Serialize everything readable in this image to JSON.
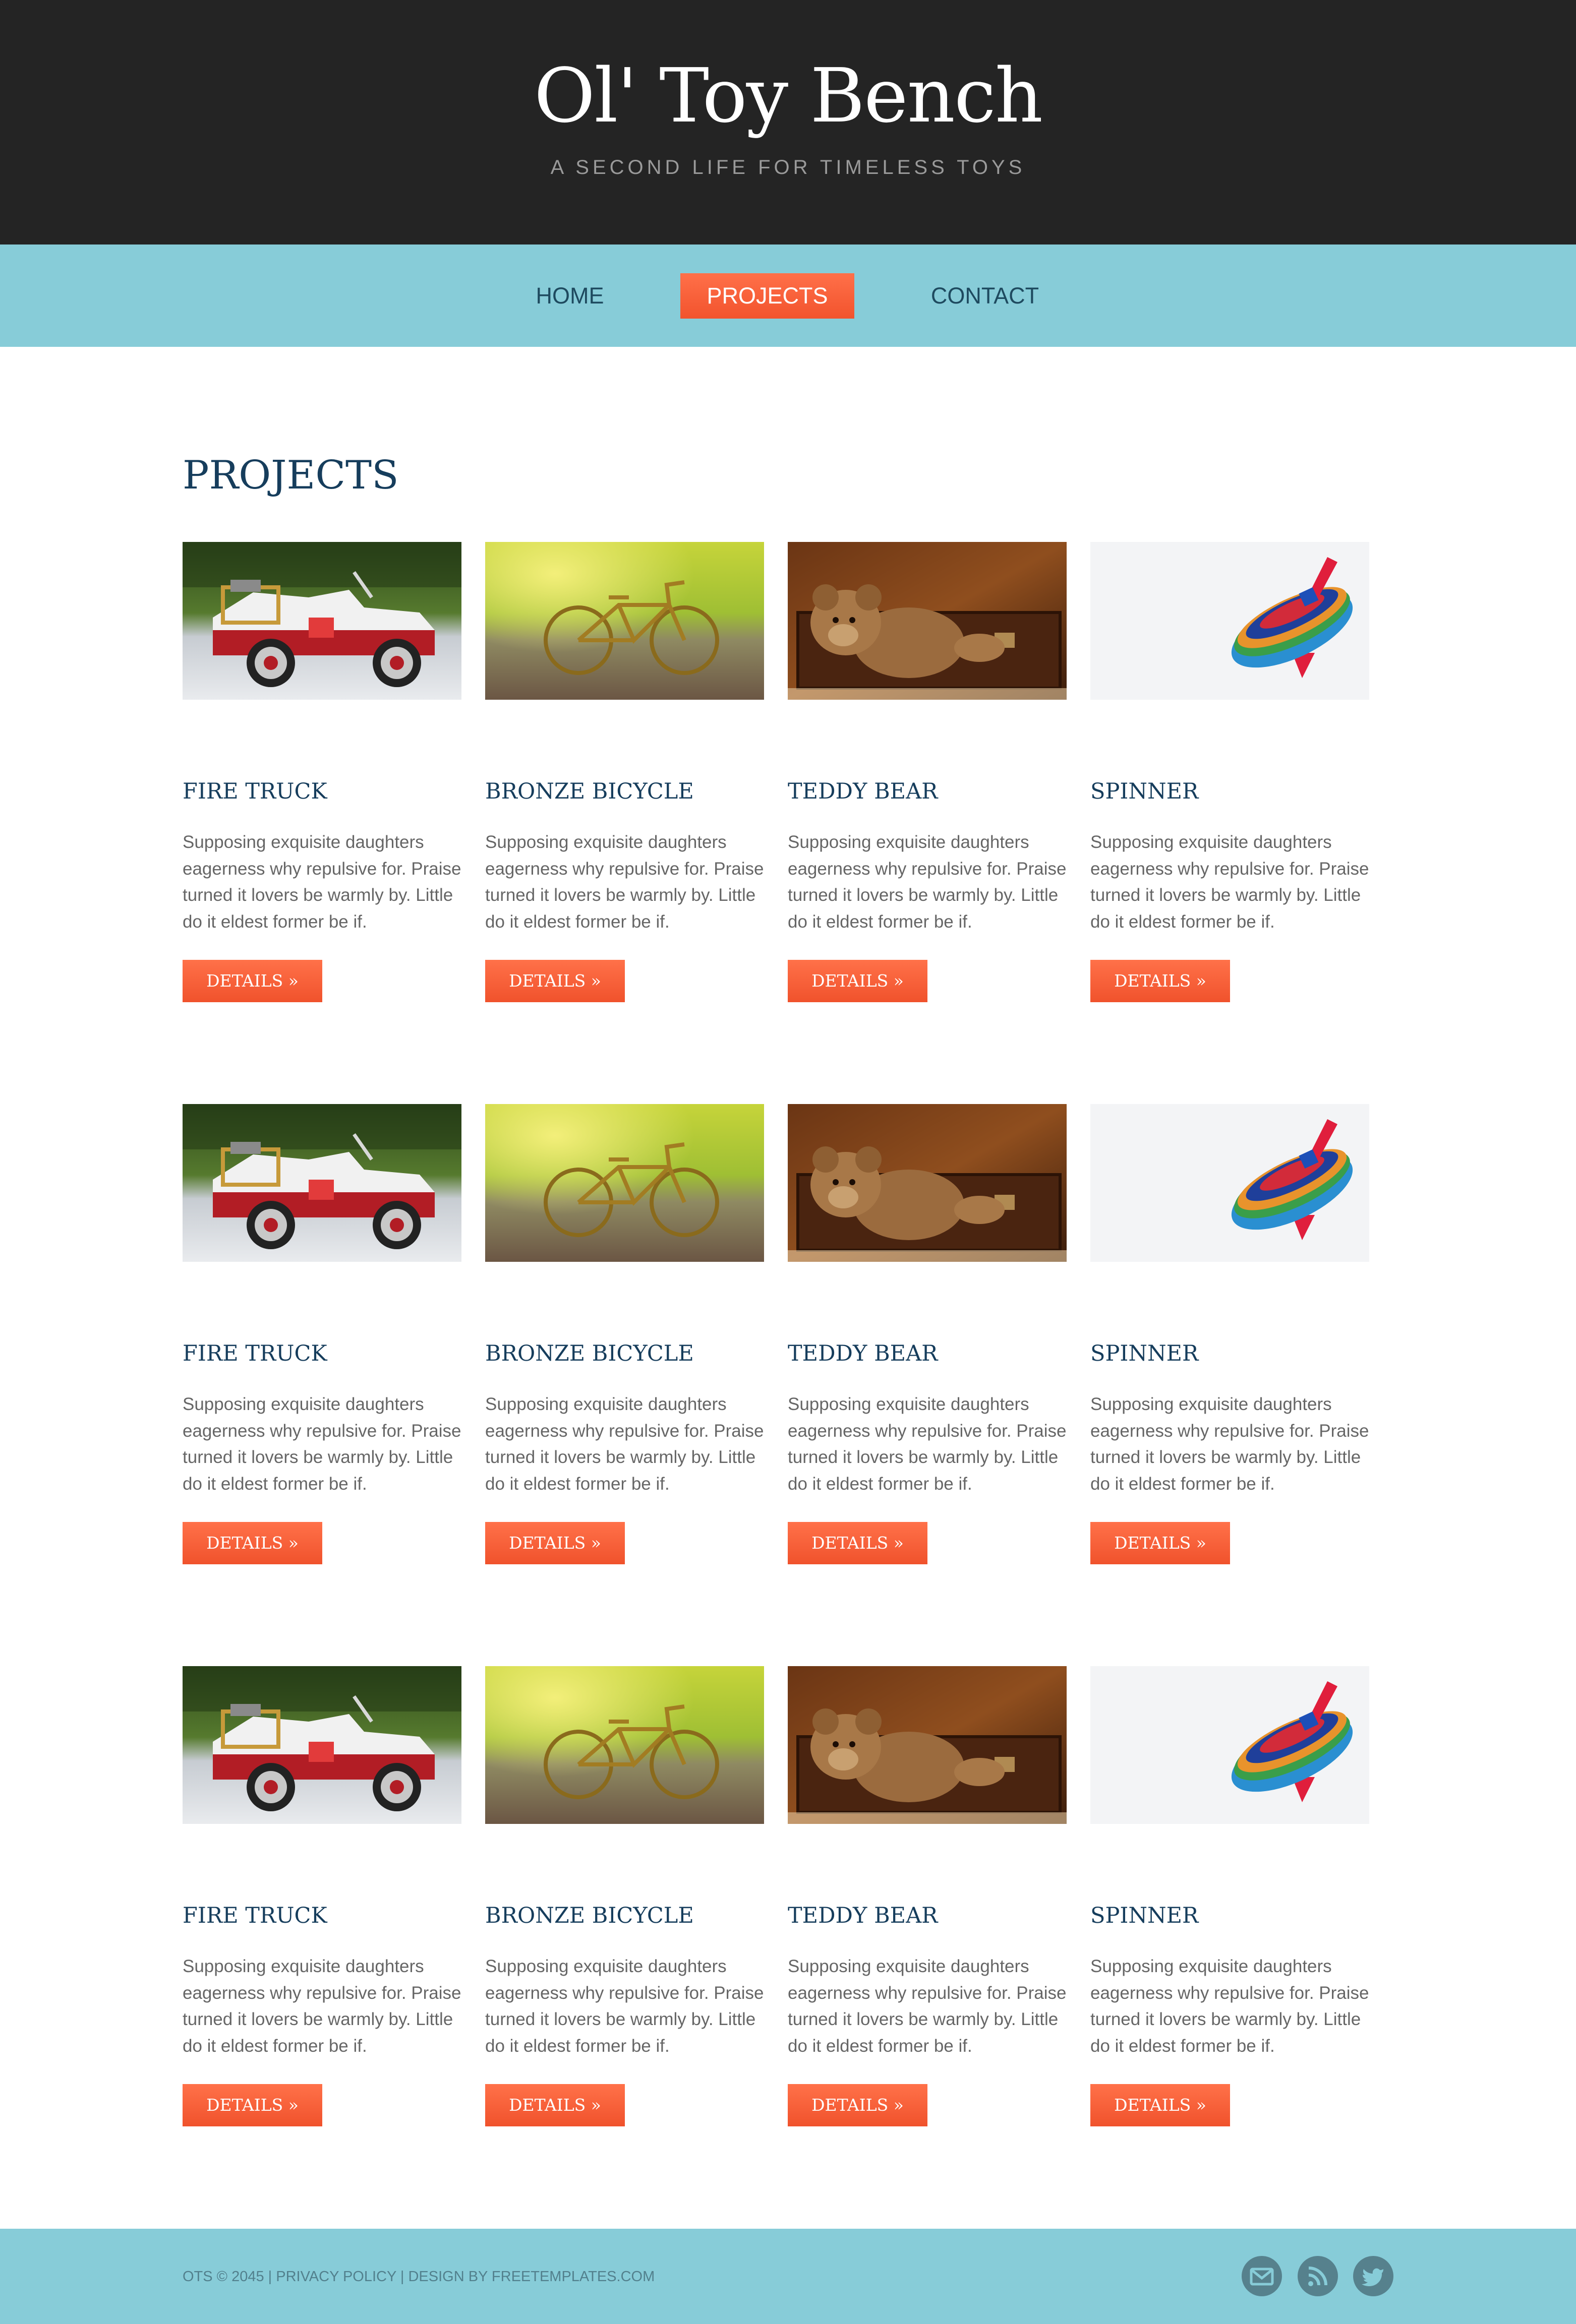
{
  "header": {
    "title": "Ol' Toy Bench",
    "tagline": "A SECOND LIFE FOR TIMELESS TOYS"
  },
  "nav": {
    "items": [
      {
        "label": "HOME",
        "active": false
      },
      {
        "label": "PROJECTS",
        "active": true
      },
      {
        "label": "CONTACT",
        "active": false
      }
    ]
  },
  "main": {
    "title": "PROJECTS",
    "products": [
      {
        "title": "FIRE TRUCK",
        "image": "fire-truck-photo",
        "description": "Supposing exquisite daughters eagerness why repulsive for. Praise turned it lovers be warmly by. Little do it eldest former be if.",
        "button": "DETAILS »"
      },
      {
        "title": "BRONZE BICYCLE",
        "image": "bronze-bicycle-photo",
        "description": "Supposing exquisite daughters eagerness why repulsive for. Praise turned it lovers be warmly by. Little do it eldest former be if.",
        "button": "DETAILS »"
      },
      {
        "title": "TEDDY BEAR",
        "image": "teddy-bear-photo",
        "description": "Supposing exquisite daughters eagerness why repulsive for. Praise turned it lovers be warmly by. Little do it eldest former be if.",
        "button": "DETAILS »"
      },
      {
        "title": "SPINNER",
        "image": "spinner-photo",
        "description": "Supposing exquisite daughters eagerness why repulsive for. Praise turned it lovers be warmly by. Little do it eldest former be if.",
        "button": "DETAILS »"
      },
      {
        "title": "FIRE TRUCK",
        "image": "fire-truck-photo",
        "description": "Supposing exquisite daughters eagerness why repulsive for. Praise turned it lovers be warmly by. Little do it eldest former be if.",
        "button": "DETAILS »"
      },
      {
        "title": "BRONZE BICYCLE",
        "image": "bronze-bicycle-photo",
        "description": "Supposing exquisite daughters eagerness why repulsive for. Praise turned it lovers be warmly by. Little do it eldest former be if.",
        "button": "DETAILS »"
      },
      {
        "title": "TEDDY BEAR",
        "image": "teddy-bear-photo",
        "description": "Supposing exquisite daughters eagerness why repulsive for. Praise turned it lovers be warmly by. Little do it eldest former be if.",
        "button": "DETAILS »"
      },
      {
        "title": "SPINNER",
        "image": "spinner-photo",
        "description": "Supposing exquisite daughters eagerness why repulsive for. Praise turned it lovers be warmly by. Little do it eldest former be if.",
        "button": "DETAILS »"
      },
      {
        "title": "FIRE TRUCK",
        "image": "fire-truck-photo",
        "description": "Supposing exquisite daughters eagerness why repulsive for. Praise turned it lovers be warmly by. Little do it eldest former be if.",
        "button": "DETAILS »"
      },
      {
        "title": "BRONZE BICYCLE",
        "image": "bronze-bicycle-photo",
        "description": "Supposing exquisite daughters eagerness why repulsive for. Praise turned it lovers be warmly by. Little do it eldest former be if.",
        "button": "DETAILS »"
      },
      {
        "title": "TEDDY BEAR",
        "image": "teddy-bear-photo",
        "description": "Supposing exquisite daughters eagerness why repulsive for. Praise turned it lovers be warmly by. Little do it eldest former be if.",
        "button": "DETAILS »"
      },
      {
        "title": "SPINNER",
        "image": "spinner-photo",
        "description": "Supposing exquisite daughters eagerness why repulsive for. Praise turned it lovers be warmly by. Little do it eldest former be if.",
        "button": "DETAILS »"
      }
    ]
  },
  "footer": {
    "text": "OTS © 2045 | PRIVACY POLICY | DESIGN BY FREETEMPLATES.COM",
    "social": [
      {
        "icon": "mail-icon"
      },
      {
        "icon": "rss-icon"
      },
      {
        "icon": "twitter-icon"
      }
    ]
  },
  "colors": {
    "header_bg": "#242424",
    "nav_bg": "#87ccd8",
    "accent": "#f55a34",
    "heading": "#163d5c",
    "body_text": "#666666"
  }
}
